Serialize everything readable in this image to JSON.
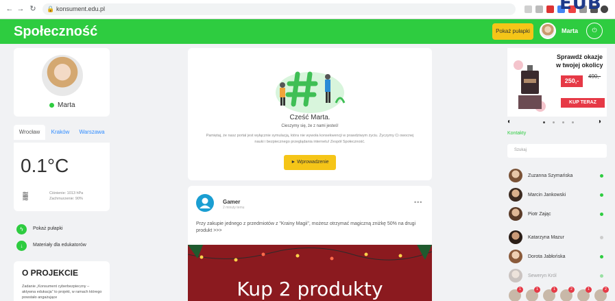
{
  "browser": {
    "url": "konsument.edu.pl",
    "overlay_text": "EUB",
    "back_icon": "arrow-left-icon",
    "forward_icon": "arrow-right-icon",
    "reload_icon": "reload-icon"
  },
  "header": {
    "brand": "Społeczność",
    "traps_button": "Pokaż pułapki",
    "user_name": "Marta",
    "logout_icon": "power-icon"
  },
  "profile": {
    "name": "Marta",
    "status": "online"
  },
  "weather": {
    "tabs": [
      "Wrocław",
      "Kraków",
      "Warszawa"
    ],
    "active_tab": "Wrocław",
    "temperature": "0.1°C",
    "pressure": "Ciśnienie: 1013 hPa",
    "cloudiness": "Zachmurzenie: 90%"
  },
  "menu": [
    {
      "label": "Pokaż pułapki",
      "icon": "lightning-icon"
    },
    {
      "label": "Materiały dla edukatorów",
      "icon": "download-icon"
    }
  ],
  "about": {
    "title": "O PROJEKCIE",
    "text": "Zadanie „Konsument cyberbezpieczny – aktywna edukacja” to projekt, w ramach którego powstało angażujące"
  },
  "welcome": {
    "title": "Cześć Marta.",
    "subtitle": "Cieszymy się, że z nami jesteś!",
    "note": "Pamiętaj, że nasz portal jest wyłącznie symulacją, która nie wywoła konsekwencji w prawdziwym życiu. Życzymy Ci owocnej nauki i bezpiecznego przeglądania internetu! Zespół Społeczność.",
    "intro_button": "► Wprowadzenie"
  },
  "post": {
    "author": "Gamer",
    "time": "2 minuty temu",
    "text": "Przy zakupie jednego z przedmiotów z \"Krainy Magii\", możesz otrzymać magiczną zniżkę 50% na drugi produkt >>>",
    "image_title": "Kup 2 produkty"
  },
  "ad": {
    "line1": "Sprawdź okazje",
    "line2": "w twojej okolicy",
    "old_price": "490,-",
    "price": "250,-",
    "buy_button": "KUP TERAZ"
  },
  "contacts": {
    "title": "Kontakty",
    "search_placeholder": "Szukaj",
    "items": [
      {
        "name": "Zuzanna Szymańska",
        "online": true
      },
      {
        "name": "Marcin Jankowski",
        "online": true
      },
      {
        "name": "Piotr Zając",
        "online": true
      },
      {
        "name": "Katarzyna Mazur",
        "online": false
      },
      {
        "name": "Dorota Jabłońska",
        "online": true
      },
      {
        "name": "Seweryn Król",
        "online": true
      }
    ]
  },
  "notifications": [
    "1",
    "1",
    "1",
    "2",
    "1",
    "2"
  ],
  "colors": {
    "brand_green": "#2ecc40",
    "accent_yellow": "#f5c518",
    "ad_red": "#e63946"
  }
}
